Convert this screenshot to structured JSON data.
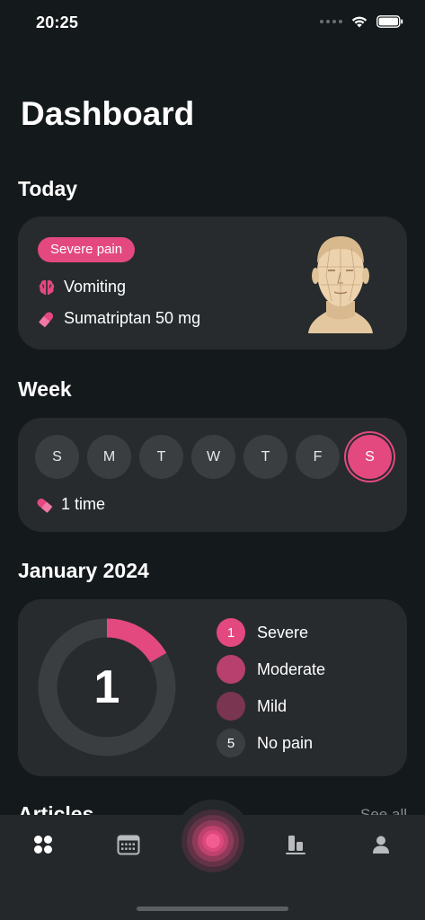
{
  "status_bar": {
    "time": "20:25"
  },
  "page": {
    "title": "Dashboard"
  },
  "today": {
    "section_title": "Today",
    "pain_badge": "Severe pain",
    "symptom": "Vomiting",
    "medication": "Sumatriptan 50 mg"
  },
  "week": {
    "section_title": "Week",
    "days": [
      "S",
      "M",
      "T",
      "W",
      "T",
      "F",
      "S"
    ],
    "selected_day_index": 6,
    "medication_count": "1 time"
  },
  "month": {
    "section_title": "January 2024",
    "center_count": "1",
    "chart_data": {
      "type": "pie",
      "categories": [
        "Severe",
        "Moderate",
        "Mild",
        "No pain"
      ],
      "values": [
        1,
        0,
        0,
        5
      ]
    },
    "legend": [
      {
        "label": "Severe",
        "count": "1",
        "color": "#e3497e"
      },
      {
        "label": "Moderate",
        "count": "",
        "color": "#b8406e"
      },
      {
        "label": "Mild",
        "count": "",
        "color": "#7a3551"
      },
      {
        "label": "No pain",
        "count": "5",
        "color": "#3a3e41"
      }
    ]
  },
  "articles": {
    "section_title": "Articles",
    "see_all": "See all"
  },
  "colors": {
    "accent": "#e3497e",
    "background": "#14191b",
    "card": "#272b2e",
    "tab_bar": "#24282b",
    "tab_icon": "#b9bbbd"
  },
  "tab_bar": {
    "tabs": [
      "dashboard-icon",
      "calendar-icon",
      "record-pain-icon",
      "statistics-icon",
      "profile-icon"
    ]
  }
}
